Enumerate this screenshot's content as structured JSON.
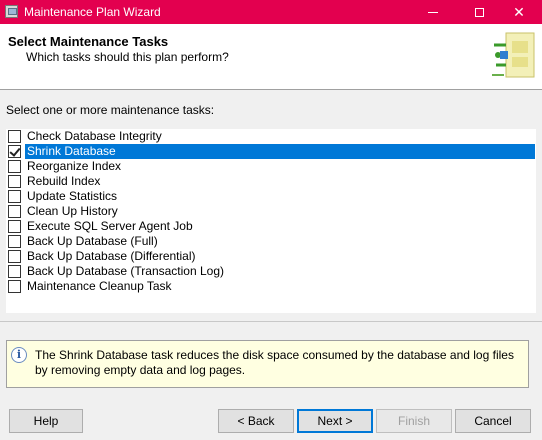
{
  "window": {
    "title": "Maintenance Plan Wizard",
    "minimize": "minimize",
    "maximize": "maximize",
    "close": "✕"
  },
  "header": {
    "title": "Select Maintenance Tasks",
    "subtitle": "Which tasks should this plan perform?",
    "graphic_icon": "wizard-banner-icon"
  },
  "tasks_label": "Select one or more maintenance tasks:",
  "tasks": [
    {
      "label": "Check Database Integrity",
      "checked": false,
      "selected": false
    },
    {
      "label": "Shrink Database",
      "checked": true,
      "selected": true
    },
    {
      "label": "Reorganize Index",
      "checked": false,
      "selected": false
    },
    {
      "label": "Rebuild Index",
      "checked": false,
      "selected": false
    },
    {
      "label": "Update Statistics",
      "checked": false,
      "selected": false
    },
    {
      "label": "Clean Up History",
      "checked": false,
      "selected": false
    },
    {
      "label": "Execute SQL Server Agent Job",
      "checked": false,
      "selected": false
    },
    {
      "label": "Back Up Database (Full)",
      "checked": false,
      "selected": false
    },
    {
      "label": "Back Up Database (Differential)",
      "checked": false,
      "selected": false
    },
    {
      "label": "Back Up Database (Transaction Log)",
      "checked": false,
      "selected": false
    },
    {
      "label": "Maintenance Cleanup Task",
      "checked": false,
      "selected": false
    }
  ],
  "info": {
    "icon": "info-icon",
    "text": "The Shrink Database task reduces the disk space consumed by the database and log files by removing empty data and log pages."
  },
  "buttons": {
    "help": "Help",
    "back": "< Back",
    "next": "Next >",
    "finish": "Finish",
    "cancel": "Cancel"
  },
  "colors": {
    "titlebar": "#e3004f",
    "selection": "#0078d7",
    "info_background": "#ffffe1"
  }
}
